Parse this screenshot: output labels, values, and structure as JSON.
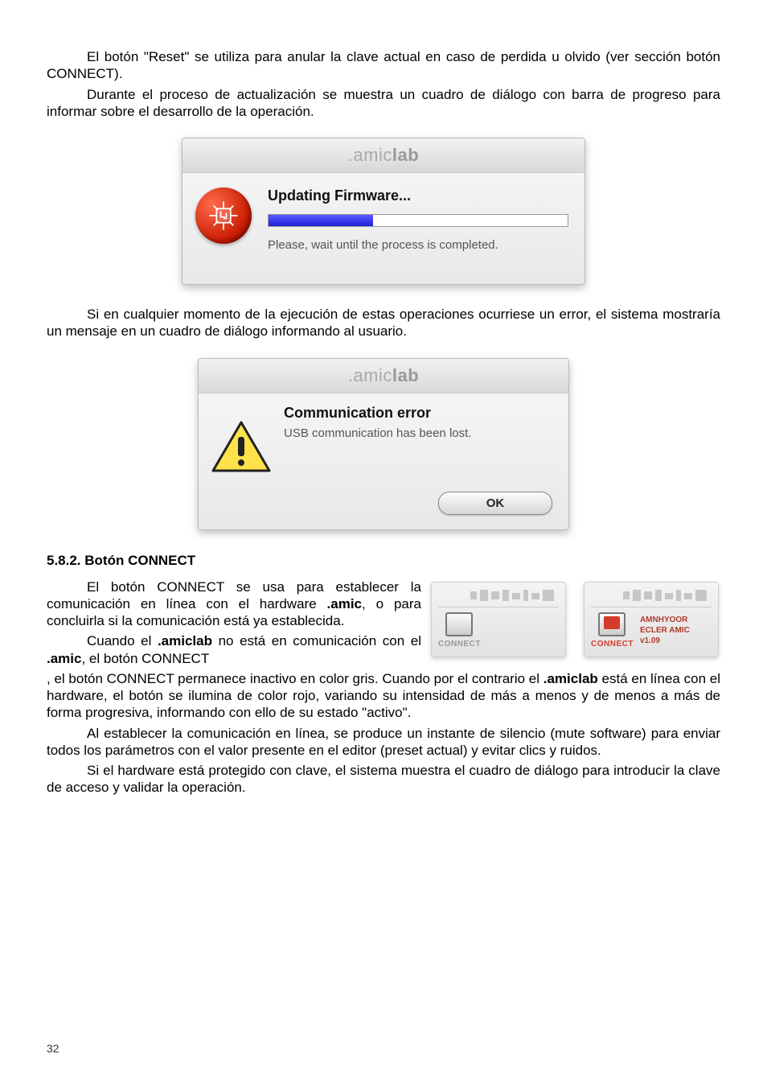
{
  "paragraphs": {
    "p1": "El botón \"Reset\" se utiliza para anular la clave actual en caso de perdida u olvido (ver sección botón CONNECT).",
    "p2a": "Durante el proceso de actualización se muestra un cuadro de diálogo con barra de progreso para informar sobre el desarrollo de la operación.",
    "p3": "Si en cualquier momento de la ejecución de estas operaciones ocurriese un error, el sistema mostraría un mensaje en un cuadro de diálogo informando al usuario.",
    "section_heading": "5.8.2. Botón CONNECT",
    "p4": "El botón CONNECT se usa para establecer la comunicación en línea con el hardware ",
    "p4b": ".amic",
    "p4c": ", o para concluirla si la comunicación está ya establecida.",
    "p5a": "Cuando el ",
    "p5b": ".amiclab",
    "p5c": " no está en comunicación con el ",
    "p5d": ".amic",
    "p5e": ", el botón CONNECT permanece inactivo en color gris. Cuando por el contrario el ",
    "p5f": ".amiclab",
    "p5g": " está en línea con el hardware, el botón se ilumina de color rojo, variando su intensidad de más a menos y de menos a más de forma progresiva, informando con ello de su estado \"activo\".",
    "p6": "Al establecer la comunicación en línea, se produce un instante de silencio (mute software) para enviar todos los parámetros con el valor presente en el editor (preset actual) y evitar clics y ruidos.",
    "p7": "Si el hardware está protegido con clave, el sistema muestra el cuadro de diálogo para introducir la clave de acceso y validar la operación."
  },
  "dialog1": {
    "title_amic": ".amic",
    "title_lab": "lab",
    "heading": "Updating Firmware...",
    "subtext": "Please, wait until the process is completed."
  },
  "dialog2": {
    "title_amic": ".amic",
    "title_lab": "lab",
    "heading": "Communication error",
    "subtext": "USB communication has been lost.",
    "ok_label": "OK"
  },
  "connect_panels": {
    "label": "CONNECT",
    "info_line1": "AMNHYOOR",
    "info_line2": "ECLER AMIC",
    "info_line3": "v1.09"
  },
  "page_number": "32"
}
